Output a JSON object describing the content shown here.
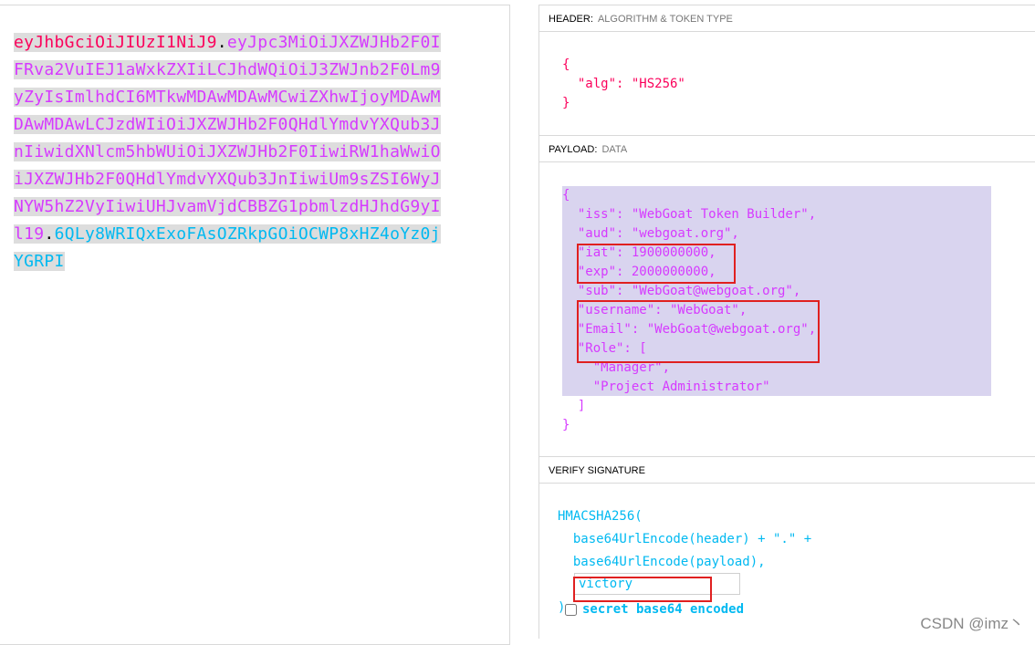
{
  "encoded": {
    "header": "eyJhbGciOiJIUzI1NiJ9",
    "dot1": ".",
    "payload": "eyJpc3MiOiJXZWJHb2F0IFRva2VuIEJ1aWxkZXIiLCJhdWQiOiJ3ZWJnb2F0Lm9yZyIsImlhdCI6MTkwMDAwMDAwMCwiZXhwIjoyMDAwMDAwMDAwLCJzdWIiOiJXZWJHb2F0QHdlYmdvYXQub3JnIiwidXNlcm5hbWUiOiJXZWJHb2F0IiwiRW1haWwiOiJXZWJHb2F0QHdlYmdvYXQub3JnIiwiUm9sZSI6WyJNYW5hZ2VyIiwiUHJvamVjdCBBZG1pbmlzdHJhdG9yIl19",
    "dot2": ".",
    "signature": "6QLy8WRIQxExoFAsOZRkpGOiOCWP8xHZ4oYz0jYGRPI"
  },
  "header_section": {
    "title": "HEADER:",
    "subtitle": "ALGORITHM & TOKEN TYPE",
    "json": "{\n  \"alg\": \"HS256\"\n}"
  },
  "payload_section": {
    "title": "PAYLOAD:",
    "subtitle": "DATA",
    "json": "{\n  \"iss\": \"WebGoat Token Builder\",\n  \"aud\": \"webgoat.org\",\n  \"iat\": 1900000000,\n  \"exp\": 2000000000,\n  \"sub\": \"WebGoat@webgoat.org\",\n  \"username\": \"WebGoat\",\n  \"Email\": \"WebGoat@webgoat.org\",\n  \"Role\": [\n    \"Manager\",\n    \"Project Administrator\"\n  ]\n}"
  },
  "verify_section": {
    "title": "VERIFY SIGNATURE",
    "code": "HMACSHA256(\n  base64UrlEncode(header) + \".\" +\n  base64UrlEncode(payload),\n\n)",
    "secret_value": "victory",
    "secret_label": "secret base64 encoded"
  },
  "watermark": "CSDN @imz丶",
  "colors": {
    "header": "#fb015b",
    "payload": "#d63aff",
    "signature": "#00b9f1",
    "highlight_box": "#e02020"
  }
}
